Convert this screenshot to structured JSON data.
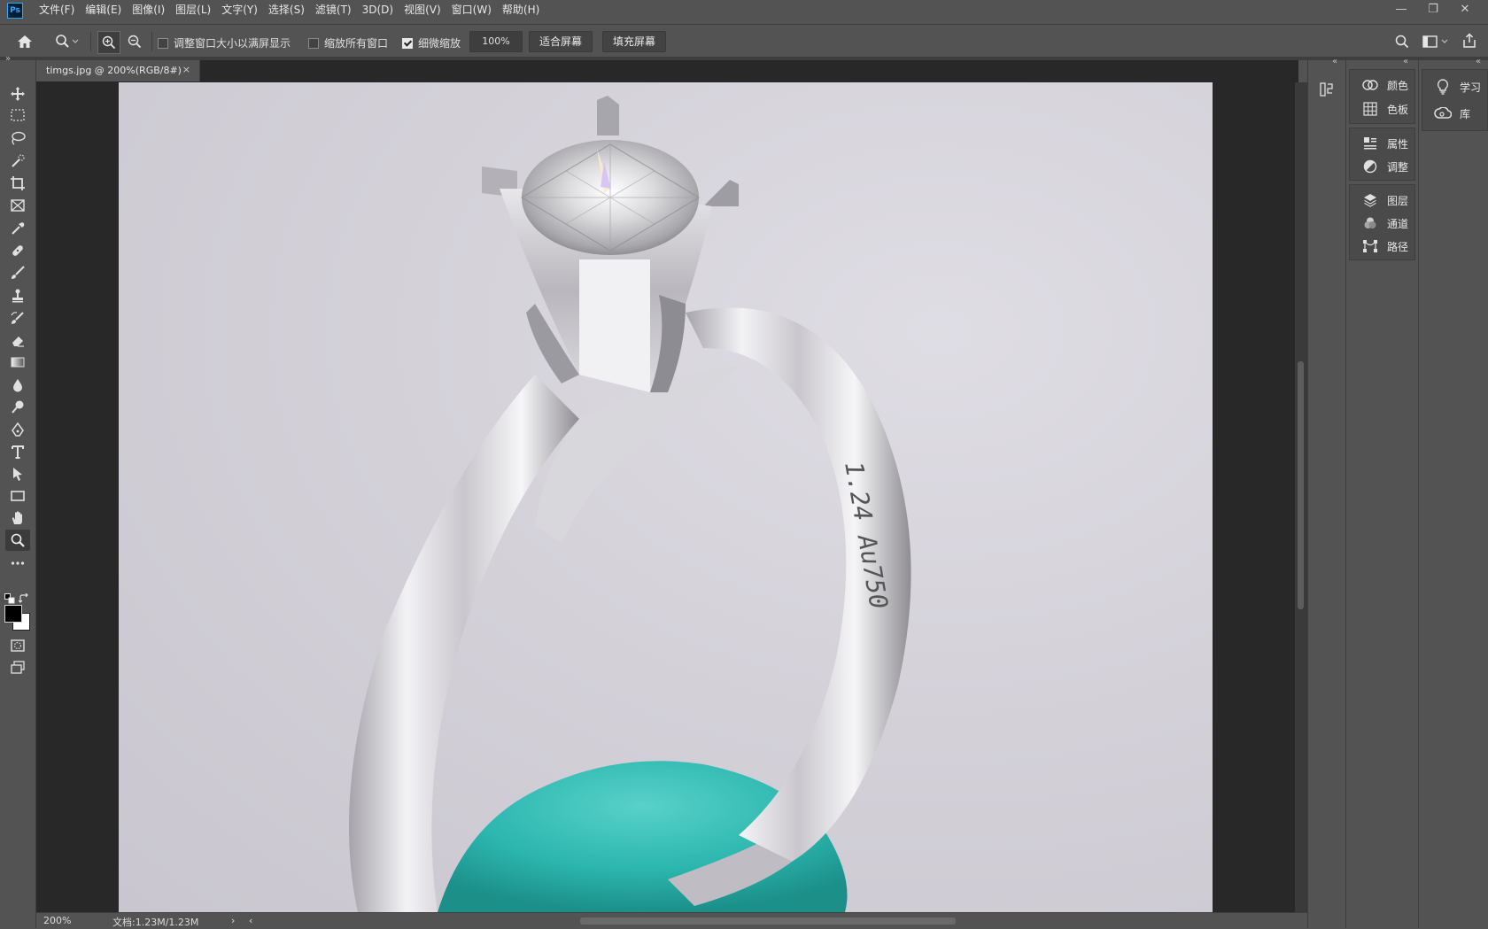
{
  "app": {
    "logo": "Ps"
  },
  "menu": [
    "文件(F)",
    "编辑(E)",
    "图像(I)",
    "图层(L)",
    "文字(Y)",
    "选择(S)",
    "滤镜(T)",
    "3D(D)",
    "视图(V)",
    "窗口(W)",
    "帮助(H)"
  ],
  "window_controls": {
    "minimize": "—",
    "restore": "❐",
    "close": "✕"
  },
  "options": {
    "resize_windows_label": "调整窗口大小以满屏显示",
    "resize_windows_checked": false,
    "zoom_all_label": "缩放所有窗口",
    "zoom_all_checked": false,
    "scrubby_zoom_label": "细微缩放",
    "scrubby_zoom_checked": true,
    "zoom_value": "100%",
    "fit_screen": "适合屏幕",
    "fill_screen": "填充屏幕"
  },
  "document": {
    "tab_title": "timgs.jpg @ 200%(RGB/8#)",
    "tab_close": "×",
    "engraving": "1.24 Au750"
  },
  "status": {
    "zoom": "200%",
    "doc_size": "文档:1.23M/1.23M"
  },
  "panels": {
    "group1": [
      "颜色",
      "色板"
    ],
    "group2": [
      "属性",
      "调整"
    ],
    "group3": [
      "图层",
      "通道",
      "路径"
    ],
    "group4": [
      "学习",
      "库"
    ]
  },
  "tools": [
    "move-tool",
    "marquee-tool",
    "lasso-tool",
    "quick-select-tool",
    "crop-tool",
    "frame-tool",
    "eyedropper-tool",
    "healing-tool",
    "brush-tool",
    "stamp-tool",
    "history-brush-tool",
    "eraser-tool",
    "gradient-tool",
    "blur-tool",
    "dodge-tool",
    "pen-tool",
    "type-tool",
    "path-select-tool",
    "rectangle-tool",
    "hand-tool",
    "zoom-tool",
    "more-tools"
  ],
  "colors": {
    "foreground": "#000000",
    "background": "#ffffff",
    "ui_bg": "#535353",
    "ui_dark": "#282828",
    "accent": "#31a8ff"
  }
}
